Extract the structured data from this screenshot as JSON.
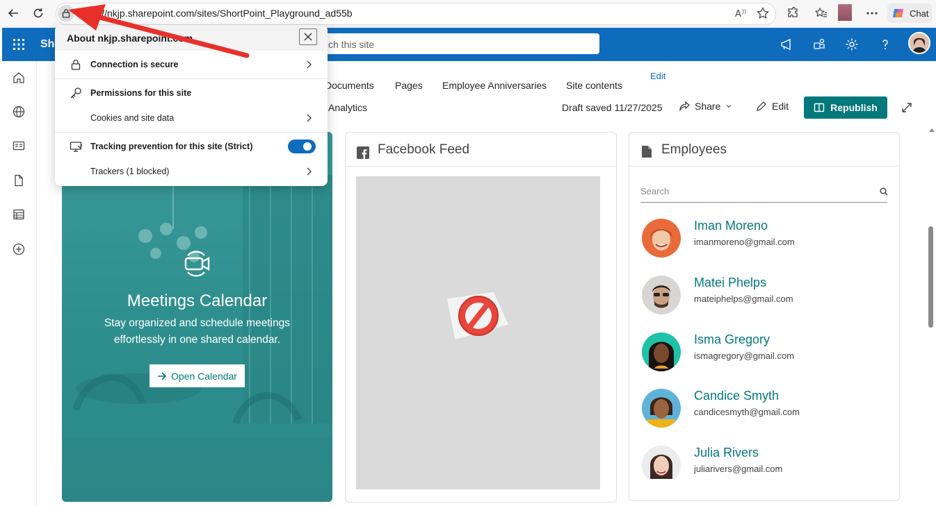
{
  "browser": {
    "url": "https://nkjp.sharepoint.com/sites/ShortPoint_Playground_ad55b",
    "chat_label": "Chat"
  },
  "suite": {
    "title": "Sha",
    "search_placeholder": "ch this site"
  },
  "nav": {
    "links": [
      "Documents",
      "Pages",
      "Employee Anniversaries",
      "Site contents"
    ],
    "edit_label": "Edit",
    "analytics": "Analytics"
  },
  "commandbar": {
    "draft_status": "Draft saved 11/27/2025",
    "share_label": "Share",
    "edit_label": "Edit",
    "republish_label": "Republish"
  },
  "meeting": {
    "title": "Meetings Calendar",
    "description": "Stay organized and schedule meetings effortlessly in one shared calendar.",
    "button_label": "Open Calendar"
  },
  "facebook": {
    "title": "Facebook Feed"
  },
  "employees": {
    "title": "Employees",
    "search_placeholder": "Search",
    "people": [
      {
        "name": "Iman Moreno",
        "email": "imanmoreno@gmail.com"
      },
      {
        "name": "Matei Phelps",
        "email": "mateiphelps@gmail.com"
      },
      {
        "name": "Isma Gregory",
        "email": "ismagregory@gmail.com"
      },
      {
        "name": "Candice Smyth",
        "email": "candicesmyth@gmail.com"
      },
      {
        "name": "Julia Rivers",
        "email": "juliarivers@gmail.com"
      }
    ]
  },
  "site_info": {
    "title": "About nkjp.sharepoint.com",
    "connection": "Connection is secure",
    "permissions": "Permissions for this site",
    "cookies": "Cookies and site data",
    "tracking": "Tracking prevention for this site (Strict)",
    "trackers": "Trackers (1 blocked)",
    "tracking_enabled": true
  },
  "colors": {
    "suite_blue": "#0f6cbd",
    "teal": "#03787c",
    "annotation_red": "#e8302a"
  }
}
